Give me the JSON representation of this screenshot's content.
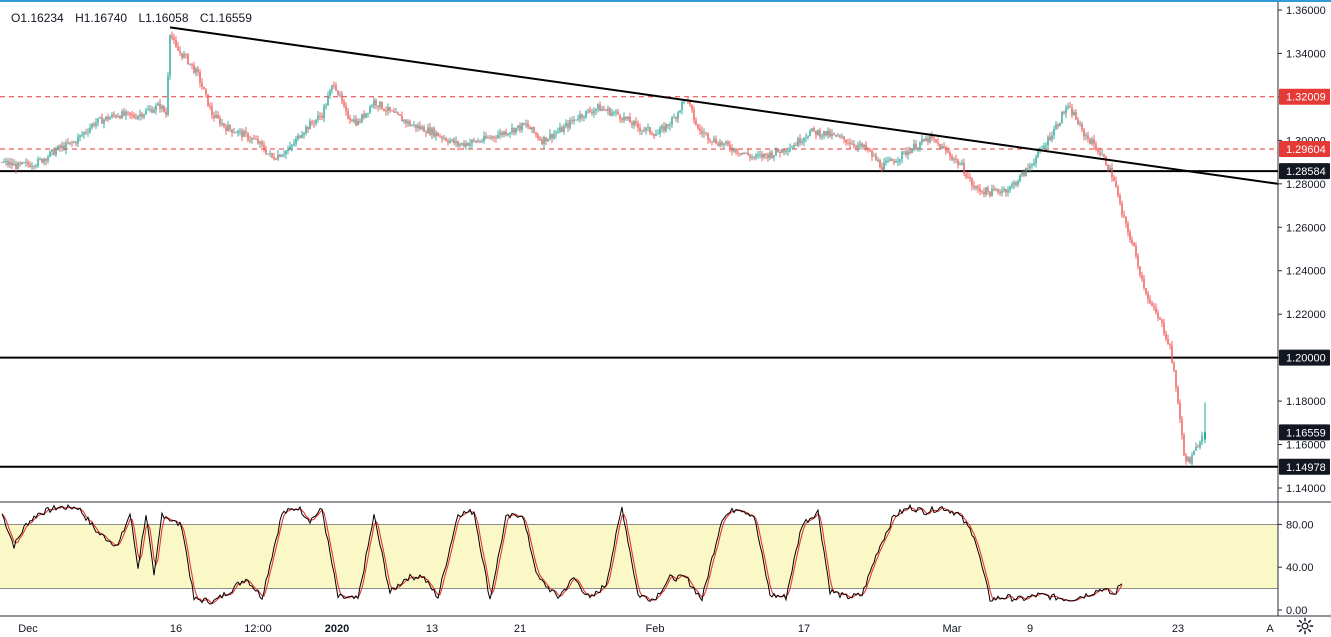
{
  "ohlc": {
    "open_label": "O1.16234",
    "high_label": "H1.16740",
    "low_label": "L1.16058",
    "close_label": "C1.16559"
  },
  "colors": {
    "up": "#26a69a",
    "down": "#ef5350",
    "accent_line": "#2e9ad6",
    "stoch_k": "#000000",
    "stoch_d": "#e53935",
    "stoch_band": "#fbf8c8",
    "resistance_dashed": "#e53935",
    "support_tag": "#131722",
    "last_price_tag": "#131722",
    "red_tag": "#e53935"
  },
  "chart_data": [
    {
      "type": "candlestick",
      "symbol_ohlc": {
        "open": 1.16234,
        "high": 1.1674,
        "low": 1.16058,
        "close": 1.16559
      },
      "ylim": [
        1.13,
        1.36
      ],
      "y_ticks": [
        "1.36000",
        "1.34000",
        "1.32000",
        "1.30000",
        "1.28000",
        "1.26000",
        "1.24000",
        "1.22000",
        "1.20000",
        "1.18000",
        "1.16000",
        "1.14000"
      ],
      "x_ticks": [
        "Dec",
        "16",
        "12:00",
        "2020",
        "13",
        "21",
        "Feb",
        "17",
        "Mar",
        "9",
        "23",
        "A"
      ],
      "bars_count": 290,
      "anchors": [
        [
          0,
          1.29
        ],
        [
          8,
          1.288
        ],
        [
          18,
          1.29
        ],
        [
          28,
          1.296
        ],
        [
          36,
          1.299
        ],
        [
          46,
          1.308
        ],
        [
          58,
          1.312
        ],
        [
          66,
          1.311
        ],
        [
          74,
          1.314
        ],
        [
          79,
          1.316
        ],
        [
          82,
          1.312
        ],
        [
          84,
          1.35
        ],
        [
          87,
          1.342
        ],
        [
          92,
          1.338
        ],
        [
          98,
          1.33
        ],
        [
          105,
          1.312
        ],
        [
          112,
          1.306
        ],
        [
          120,
          1.303
        ],
        [
          128,
          1.299
        ],
        [
          135,
          1.292
        ],
        [
          144,
          1.296
        ],
        [
          150,
          1.304
        ],
        [
          160,
          1.312
        ],
        [
          166,
          1.327
        ],
        [
          172,
          1.312
        ],
        [
          178,
          1.308
        ],
        [
          186,
          1.318
        ],
        [
          194,
          1.313
        ],
        [
          205,
          1.307
        ],
        [
          215,
          1.304
        ],
        [
          228,
          1.298
        ],
        [
          240,
          1.3
        ],
        [
          252,
          1.304
        ],
        [
          262,
          1.307
        ],
        [
          270,
          1.3
        ],
        [
          280,
          1.305
        ],
        [
          288,
          1.311
        ],
        [
          298,
          1.315
        ],
        [
          308,
          1.312
        ],
        [
          318,
          1.306
        ],
        [
          328,
          1.303
        ],
        [
          336,
          1.31
        ],
        [
          342,
          1.32
        ],
        [
          348,
          1.305
        ],
        [
          356,
          1.3
        ],
        [
          366,
          1.296
        ],
        [
          376,
          1.292
        ],
        [
          386,
          1.294
        ],
        [
          396,
          1.298
        ],
        [
          404,
          1.304
        ],
        [
          412,
          1.303
        ],
        [
          422,
          1.3
        ],
        [
          432,
          1.296
        ],
        [
          440,
          1.288
        ],
        [
          448,
          1.292
        ],
        [
          456,
          1.297
        ],
        [
          464,
          1.301
        ],
        [
          472,
          1.295
        ],
        [
          480,
          1.288
        ],
        [
          486,
          1.278
        ],
        [
          494,
          1.276
        ],
        [
          504,
          1.278
        ],
        [
          512,
          1.286
        ],
        [
          520,
          1.296
        ],
        [
          528,
          1.308
        ],
        [
          532,
          1.315
        ],
        [
          536,
          1.312
        ],
        [
          540,
          1.304
        ],
        [
          546,
          1.298
        ],
        [
          552,
          1.29
        ],
        [
          556,
          1.282
        ],
        [
          560,
          1.266
        ],
        [
          566,
          1.25
        ],
        [
          570,
          1.236
        ],
        [
          574,
          1.225
        ],
        [
          580,
          1.215
        ],
        [
          584,
          1.205
        ],
        [
          588,
          1.18
        ],
        [
          591,
          1.155
        ],
        [
          594,
          1.152
        ],
        [
          597,
          1.158
        ],
        [
          600,
          1.165
        ]
      ],
      "horizontal_levels": [
        {
          "price": 1.32009,
          "label": "1.32009",
          "style": "dashed",
          "color": "#e53935"
        },
        {
          "price": 1.29604,
          "label": "1.29604",
          "style": "dashed",
          "color": "#e53935"
        },
        {
          "price": 1.28584,
          "label": "1.28584",
          "style": "solid",
          "color": "#000000"
        },
        {
          "price": 1.2,
          "label": "1.20000",
          "style": "solid",
          "color": "#000000"
        },
        {
          "price": 1.14978,
          "label": "1.14978",
          "style": "solid",
          "color": "#000000"
        }
      ],
      "trendline": {
        "from": [
          84,
          1.352
        ],
        "to": [
          700,
          1.28
        ]
      },
      "last_price": {
        "price": 1.16559,
        "label": "1.16559"
      }
    },
    {
      "type": "line",
      "indicator": "stochastic",
      "ylim": [
        0,
        100
      ],
      "y_ticks": [
        "80.00",
        "40.00",
        "0.00"
      ],
      "band": [
        20,
        80
      ],
      "series": [
        {
          "role": "k"
        },
        {
          "role": "d"
        }
      ],
      "anchors": [
        [
          0,
          90
        ],
        [
          6,
          60
        ],
        [
          12,
          80
        ],
        [
          18,
          90
        ],
        [
          28,
          96
        ],
        [
          38,
          96
        ],
        [
          48,
          72
        ],
        [
          58,
          60
        ],
        [
          64,
          90
        ],
        [
          68,
          40
        ],
        [
          72,
          90
        ],
        [
          76,
          30
        ],
        [
          80,
          90
        ],
        [
          84,
          85
        ],
        [
          90,
          78
        ],
        [
          96,
          10
        ],
        [
          106,
          8
        ],
        [
          114,
          18
        ],
        [
          122,
          30
        ],
        [
          130,
          12
        ],
        [
          140,
          90
        ],
        [
          148,
          96
        ],
        [
          154,
          84
        ],
        [
          160,
          94
        ],
        [
          168,
          12
        ],
        [
          178,
          10
        ],
        [
          186,
          88
        ],
        [
          194,
          16
        ],
        [
          202,
          30
        ],
        [
          210,
          32
        ],
        [
          218,
          12
        ],
        [
          228,
          90
        ],
        [
          236,
          92
        ],
        [
          244,
          10
        ],
        [
          252,
          86
        ],
        [
          260,
          90
        ],
        [
          268,
          30
        ],
        [
          278,
          12
        ],
        [
          286,
          30
        ],
        [
          294,
          10
        ],
        [
          302,
          24
        ],
        [
          310,
          96
        ],
        [
          318,
          14
        ],
        [
          326,
          10
        ],
        [
          334,
          30
        ],
        [
          342,
          30
        ],
        [
          350,
          10
        ],
        [
          360,
          86
        ],
        [
          368,
          96
        ],
        [
          376,
          88
        ],
        [
          384,
          14
        ],
        [
          392,
          12
        ],
        [
          400,
          80
        ],
        [
          408,
          92
        ],
        [
          414,
          18
        ],
        [
          422,
          12
        ],
        [
          430,
          14
        ],
        [
          438,
          56
        ],
        [
          446,
          88
        ],
        [
          454,
          96
        ],
        [
          462,
          92
        ],
        [
          470,
          96
        ],
        [
          478,
          90
        ],
        [
          486,
          70
        ],
        [
          494,
          10
        ],
        [
          502,
          12
        ],
        [
          510,
          10
        ],
        [
          518,
          14
        ],
        [
          526,
          12
        ],
        [
          534,
          10
        ],
        [
          542,
          14
        ],
        [
          550,
          20
        ],
        [
          556,
          14
        ],
        [
          560,
          26
        ]
      ]
    }
  ]
}
